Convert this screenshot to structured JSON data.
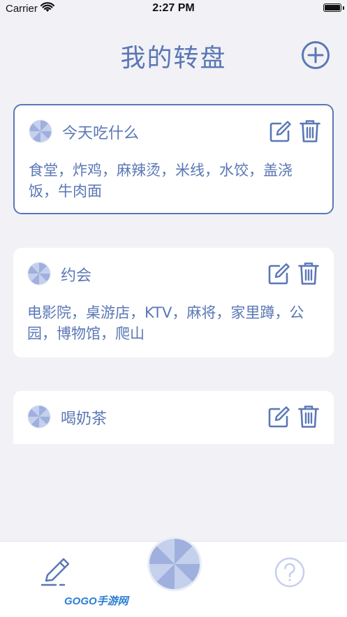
{
  "status_bar": {
    "carrier": "Carrier",
    "time": "2:27 PM"
  },
  "header": {
    "title": "我的转盘"
  },
  "wheels": [
    {
      "title": "今天吃什么",
      "items": "食堂，炸鸡，麻辣烫，米线，水饺，盖浇饭，牛肉面",
      "selected": true
    },
    {
      "title": "约会",
      "items": "电影院，桌游店，KTV，麻将，家里蹲，公园，博物馆，爬山",
      "selected": false
    },
    {
      "title": "喝奶茶",
      "items": "",
      "selected": false
    }
  ],
  "watermark": {
    "text": "GOGO手游网"
  },
  "colors": {
    "accent": "#5a77b6",
    "wheel_light": "#c5d0ec",
    "wheel_mid": "#9fb0de",
    "background": "#f2f2f6"
  },
  "icons": {
    "add": "plus-circle-icon",
    "edit": "edit-square-icon",
    "delete": "trash-icon",
    "tab_edit": "pencil-icon",
    "tab_spin": "spin-wheel-icon",
    "tab_help": "question-circle-icon"
  }
}
